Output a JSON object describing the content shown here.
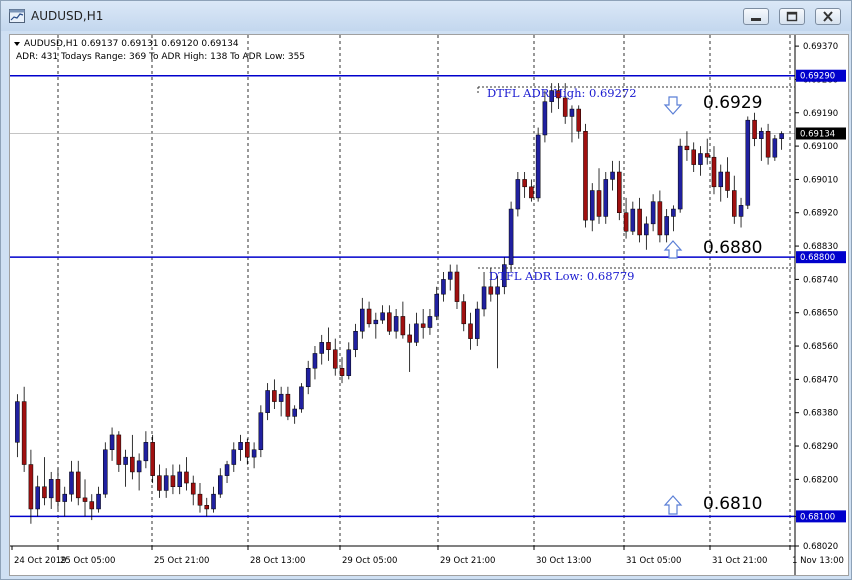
{
  "window": {
    "title": "AUDUSD,H1"
  },
  "header": {
    "line1": "AUDUSD,H1  0.69137 0.69131 0.69120 0.69134",
    "line2": "ADR: 431  Todays Range: 369  To ADR High: 138  To ADR Low: 355"
  },
  "colors": {
    "level_line": "#0000cc",
    "bull": "#2020a0",
    "bear": "#a01010",
    "grid": "#000000"
  },
  "icons": [
    "chart-window-icon",
    "minimize-icon",
    "restore-icon",
    "close-icon",
    "arrow-down-icon",
    "arrow-up-icon"
  ],
  "annotations": {
    "adr_high_label": "DTFL ADR High: 0.69272",
    "adr_low_label": "DTFL ADR Low: 0.68779",
    "level_high": "0.6929",
    "level_mid": "0.6880",
    "level_low": "0.6810"
  },
  "chart_data": {
    "type": "candlestick",
    "ylim": [
      0.6802,
      0.694
    ],
    "yticks": [
      "0.69370",
      "0.69280",
      "0.69190",
      "0.69100",
      "0.69010",
      "0.68920",
      "0.68830",
      "0.68740",
      "0.68650",
      "0.68560",
      "0.68470",
      "0.68380",
      "0.68290",
      "0.68200",
      "0.68100",
      "0.68020"
    ],
    "price_tags": [
      {
        "value": 0.6929,
        "label": "0.69290",
        "kind": "level"
      },
      {
        "value": 0.69134,
        "label": "0.69134",
        "kind": "current"
      },
      {
        "value": 0.688,
        "label": "0.68800",
        "kind": "level"
      },
      {
        "value": 0.681,
        "label": "0.68100",
        "kind": "level"
      }
    ],
    "horizontal_levels": [
      0.6929,
      0.688,
      0.681
    ],
    "xticks": [
      "24 Oct 2019",
      "25 Oct 05:00",
      "25 Oct 21:00",
      "28 Oct 13:00",
      "29 Oct 05:00",
      "29 Oct 21:00",
      "30 Oct 13:00",
      "31 Oct 05:00",
      "31 Oct 21:00",
      "1 Nov 13:00"
    ],
    "ohlc": [
      [
        0.683,
        0.6843,
        0.6826,
        0.6841
      ],
      [
        0.6841,
        0.6845,
        0.6822,
        0.6824
      ],
      [
        0.6824,
        0.6828,
        0.6808,
        0.6812
      ],
      [
        0.6812,
        0.6821,
        0.681,
        0.6818
      ],
      [
        0.6818,
        0.6826,
        0.6813,
        0.6815
      ],
      [
        0.6815,
        0.6822,
        0.6812,
        0.682
      ],
      [
        0.682,
        0.6823,
        0.6812,
        0.6814
      ],
      [
        0.6814,
        0.6818,
        0.681,
        0.6816
      ],
      [
        0.6816,
        0.6825,
        0.6814,
        0.6822
      ],
      [
        0.6822,
        0.6825,
        0.6813,
        0.6815
      ],
      [
        0.6815,
        0.682,
        0.681,
        0.6814
      ],
      [
        0.6814,
        0.6816,
        0.6809,
        0.6812
      ],
      [
        0.6812,
        0.6818,
        0.6811,
        0.6816
      ],
      [
        0.6816,
        0.683,
        0.6815,
        0.6828
      ],
      [
        0.6828,
        0.6834,
        0.6825,
        0.6832
      ],
      [
        0.6832,
        0.6833,
        0.6822,
        0.6824
      ],
      [
        0.6824,
        0.6828,
        0.6818,
        0.6826
      ],
      [
        0.6826,
        0.6832,
        0.682,
        0.6822
      ],
      [
        0.6822,
        0.6827,
        0.6817,
        0.6825
      ],
      [
        0.6825,
        0.6833,
        0.6823,
        0.683
      ],
      [
        0.683,
        0.6832,
        0.6819,
        0.6821
      ],
      [
        0.6821,
        0.6824,
        0.6815,
        0.6817
      ],
      [
        0.6817,
        0.6823,
        0.6815,
        0.6821
      ],
      [
        0.6821,
        0.6824,
        0.6816,
        0.6818
      ],
      [
        0.6818,
        0.6824,
        0.6816,
        0.6822
      ],
      [
        0.6822,
        0.6826,
        0.6817,
        0.6819
      ],
      [
        0.6819,
        0.6821,
        0.6813,
        0.6816
      ],
      [
        0.6816,
        0.6819,
        0.6811,
        0.6813
      ],
      [
        0.6813,
        0.6815,
        0.681,
        0.6812
      ],
      [
        0.6812,
        0.6818,
        0.6811,
        0.6816
      ],
      [
        0.6816,
        0.6823,
        0.6815,
        0.6821
      ],
      [
        0.6821,
        0.6825,
        0.6819,
        0.6824
      ],
      [
        0.6824,
        0.683,
        0.6822,
        0.6828
      ],
      [
        0.6828,
        0.6832,
        0.6825,
        0.683
      ],
      [
        0.683,
        0.6831,
        0.6824,
        0.6826
      ],
      [
        0.6826,
        0.683,
        0.6823,
        0.6828
      ],
      [
        0.6828,
        0.684,
        0.6826,
        0.6838
      ],
      [
        0.6838,
        0.6846,
        0.6836,
        0.6844
      ],
      [
        0.6844,
        0.6847,
        0.6839,
        0.6841
      ],
      [
        0.6841,
        0.6845,
        0.6837,
        0.6843
      ],
      [
        0.6843,
        0.6845,
        0.6836,
        0.6837
      ],
      [
        0.6837,
        0.684,
        0.6835,
        0.6839
      ],
      [
        0.6839,
        0.6846,
        0.6838,
        0.6845
      ],
      [
        0.6845,
        0.6852,
        0.6843,
        0.685
      ],
      [
        0.685,
        0.6856,
        0.6847,
        0.6854
      ],
      [
        0.6854,
        0.6859,
        0.6851,
        0.6857
      ],
      [
        0.6857,
        0.6861,
        0.6852,
        0.6855
      ],
      [
        0.6855,
        0.6858,
        0.6848,
        0.685
      ],
      [
        0.685,
        0.6853,
        0.6846,
        0.6848
      ],
      [
        0.6848,
        0.6857,
        0.6847,
        0.6855
      ],
      [
        0.6855,
        0.6862,
        0.6853,
        0.686
      ],
      [
        0.686,
        0.6869,
        0.6858,
        0.6866
      ],
      [
        0.6866,
        0.6868,
        0.6861,
        0.6862
      ],
      [
        0.6862,
        0.6865,
        0.6858,
        0.6863
      ],
      [
        0.6863,
        0.6867,
        0.6862,
        0.6865
      ],
      [
        0.6865,
        0.6867,
        0.6859,
        0.686
      ],
      [
        0.686,
        0.6866,
        0.6858,
        0.6864
      ],
      [
        0.6864,
        0.6868,
        0.6858,
        0.6859
      ],
      [
        0.6859,
        0.6862,
        0.6849,
        0.6857
      ],
      [
        0.6857,
        0.6865,
        0.6856,
        0.6862
      ],
      [
        0.6862,
        0.6866,
        0.6858,
        0.6861
      ],
      [
        0.6861,
        0.6866,
        0.6859,
        0.6864
      ],
      [
        0.6864,
        0.6872,
        0.6863,
        0.687
      ],
      [
        0.687,
        0.6876,
        0.6868,
        0.6874
      ],
      [
        0.6874,
        0.6878,
        0.6871,
        0.6876
      ],
      [
        0.6876,
        0.6878,
        0.6866,
        0.6868
      ],
      [
        0.6868,
        0.687,
        0.686,
        0.6862
      ],
      [
        0.6862,
        0.6865,
        0.6855,
        0.6858
      ],
      [
        0.6858,
        0.6868,
        0.6856,
        0.6866
      ],
      [
        0.6866,
        0.6876,
        0.6864,
        0.6872
      ],
      [
        0.6872,
        0.6877,
        0.6868,
        0.687
      ],
      [
        0.687,
        0.6875,
        0.685,
        0.6872
      ],
      [
        0.6872,
        0.688,
        0.687,
        0.6878
      ],
      [
        0.6878,
        0.6895,
        0.6876,
        0.6893
      ],
      [
        0.6893,
        0.6903,
        0.6891,
        0.6901
      ],
      [
        0.6901,
        0.6903,
        0.6896,
        0.6899
      ],
      [
        0.6899,
        0.6901,
        0.6895,
        0.6896
      ],
      [
        0.6896,
        0.6915,
        0.6895,
        0.6913
      ],
      [
        0.6913,
        0.6925,
        0.6911,
        0.6922
      ],
      [
        0.6922,
        0.6927,
        0.6919,
        0.6925
      ],
      [
        0.6925,
        0.6927,
        0.692,
        0.6923
      ],
      [
        0.6923,
        0.6927,
        0.6916,
        0.6918
      ],
      [
        0.6918,
        0.6921,
        0.6911,
        0.692
      ],
      [
        0.692,
        0.6921,
        0.6912,
        0.6914
      ],
      [
        0.6914,
        0.6916,
        0.6888,
        0.689
      ],
      [
        0.689,
        0.69,
        0.6887,
        0.6898
      ],
      [
        0.6898,
        0.6904,
        0.6889,
        0.6891
      ],
      [
        0.6891,
        0.6903,
        0.6889,
        0.6901
      ],
      [
        0.6901,
        0.6906,
        0.6898,
        0.6903
      ],
      [
        0.6903,
        0.6906,
        0.689,
        0.6892
      ],
      [
        0.6892,
        0.6896,
        0.6885,
        0.6887
      ],
      [
        0.6887,
        0.6895,
        0.6886,
        0.6893
      ],
      [
        0.6893,
        0.6896,
        0.6884,
        0.6886
      ],
      [
        0.6886,
        0.6891,
        0.6882,
        0.6889
      ],
      [
        0.6889,
        0.6897,
        0.6887,
        0.6895
      ],
      [
        0.6895,
        0.6898,
        0.6884,
        0.6886
      ],
      [
        0.6886,
        0.6893,
        0.6884,
        0.6891
      ],
      [
        0.6891,
        0.6894,
        0.6887,
        0.6893
      ],
      [
        0.6893,
        0.6912,
        0.6892,
        0.691
      ],
      [
        0.691,
        0.6914,
        0.6906,
        0.6909
      ],
      [
        0.6909,
        0.6911,
        0.6903,
        0.6905
      ],
      [
        0.6905,
        0.691,
        0.6902,
        0.6908
      ],
      [
        0.6908,
        0.6912,
        0.6905,
        0.6907
      ],
      [
        0.6907,
        0.691,
        0.6897,
        0.6899
      ],
      [
        0.6899,
        0.6905,
        0.6895,
        0.6903
      ],
      [
        0.6903,
        0.6907,
        0.6896,
        0.6898
      ],
      [
        0.6898,
        0.6902,
        0.6889,
        0.6891
      ],
      [
        0.6891,
        0.6896,
        0.6888,
        0.6894
      ],
      [
        0.6894,
        0.6918,
        0.6893,
        0.6917
      ],
      [
        0.6917,
        0.6919,
        0.691,
        0.6912
      ],
      [
        0.6912,
        0.6915,
        0.6906,
        0.6914
      ],
      [
        0.6914,
        0.6916,
        0.6905,
        0.6907
      ],
      [
        0.6907,
        0.6913,
        0.6906,
        0.6912
      ],
      [
        0.6912,
        0.6914,
        0.6909,
        0.69134
      ]
    ]
  }
}
